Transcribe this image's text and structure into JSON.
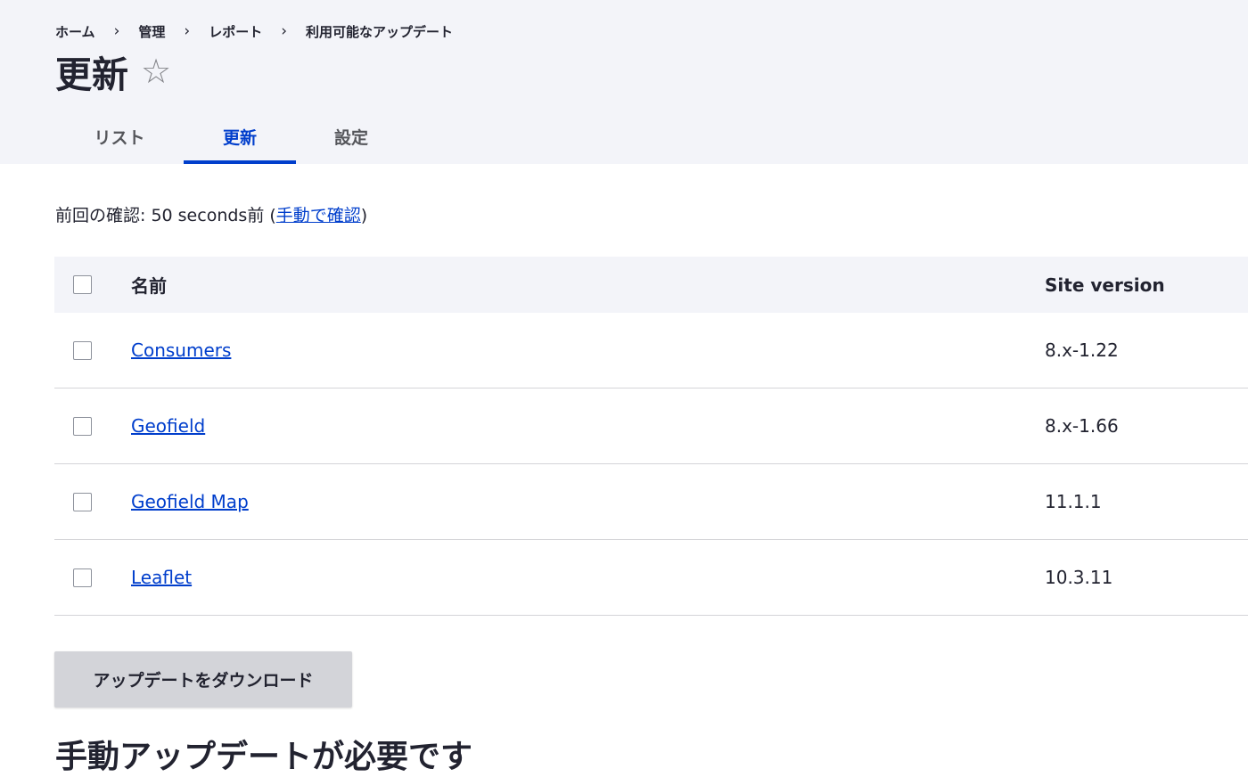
{
  "breadcrumb": {
    "items": [
      "ホーム",
      "管理",
      "レポート",
      "利用可能なアップデート"
    ],
    "separator": "›"
  },
  "page": {
    "title": "更新",
    "star": "☆"
  },
  "tabs": [
    "リスト",
    "更新",
    "設定"
  ],
  "last_checked": {
    "prefix": "前回の確認: 50 seconds前 (",
    "link": "手動で確認",
    "suffix": ")"
  },
  "table": {
    "headers": {
      "name": "名前",
      "version": "Site version"
    },
    "rows": [
      {
        "name": "Consumers",
        "version": "8.x-1.22"
      },
      {
        "name": "Geofield",
        "version": "8.x-1.66"
      },
      {
        "name": "Geofield Map",
        "version": "11.1.1"
      },
      {
        "name": "Leaflet",
        "version": "10.3.11"
      }
    ]
  },
  "download_button": "アップデートをダウンロード",
  "section_title": "手動アップデートが必要です",
  "colors": {
    "accent": "#003ecc",
    "header_bg": "#f3f4f9",
    "button_bg": "#d3d4d9"
  }
}
